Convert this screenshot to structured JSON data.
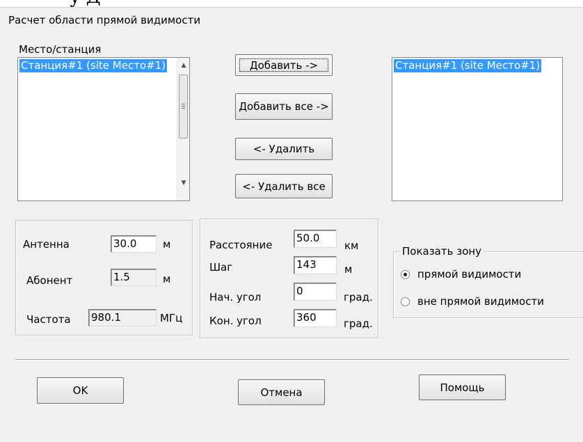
{
  "doc_fragment": "у Д",
  "dialog": {
    "title": "Расчет области прямой видимости"
  },
  "source_list": {
    "label": "Место/станция",
    "items": [
      "Станция#1 (site Место#1)"
    ]
  },
  "target_list": {
    "items": [
      "Станция#1 (site Место#1)"
    ]
  },
  "buttons": {
    "add": "Добавить ->",
    "add_all": "Добавить все ->",
    "remove": "<- Удалить",
    "remove_all": "<- Удалить все",
    "ok": "OK",
    "cancel": "Отмена",
    "help": "Помощь"
  },
  "antenna_group": {
    "antenna": {
      "label": "Антенна",
      "value": "30.0",
      "unit": "м"
    },
    "subscriber": {
      "label": "Абонент",
      "value": "1.5",
      "unit": "м"
    },
    "frequency": {
      "label": "Частота",
      "value": "980.1",
      "unit": "МГц"
    }
  },
  "calc_group": {
    "distance": {
      "label": "Расстояние",
      "value": "50.0",
      "unit": "км"
    },
    "step": {
      "label": "Шаг",
      "value": "143",
      "unit": "м"
    },
    "start_angle": {
      "label": "Нач. угол",
      "value": "0",
      "unit": "град."
    },
    "end_angle": {
      "label": "Кон. угол",
      "value": "360",
      "unit": "град."
    }
  },
  "zone_group": {
    "legend": "Показать зону",
    "options": [
      {
        "label": "прямой видимости",
        "selected": true
      },
      {
        "label": "вне прямой видимости",
        "selected": false
      }
    ]
  },
  "icons": {
    "scroll_up": "▲",
    "scroll_down": "▼"
  }
}
